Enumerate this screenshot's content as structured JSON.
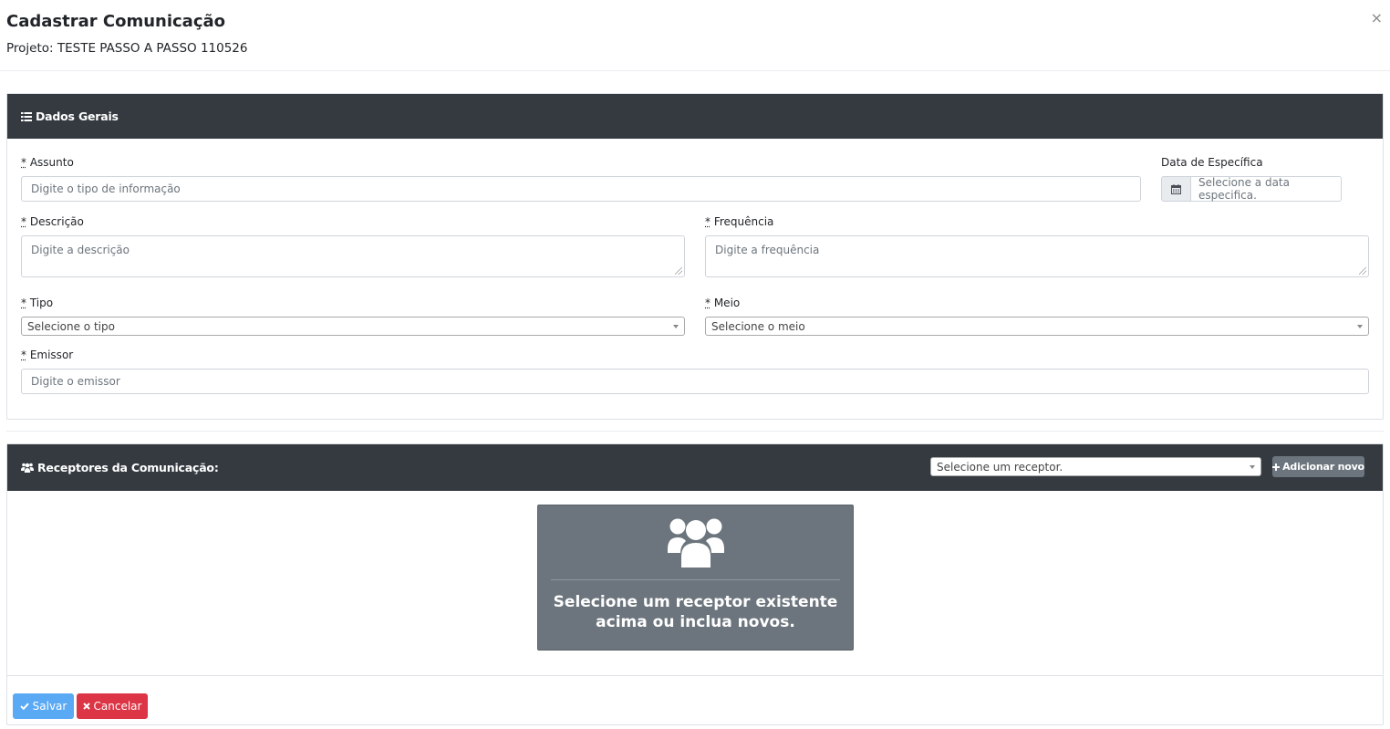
{
  "modal": {
    "title": "Cadastrar Comunicação",
    "subtitle": "Projeto: TESTE PASSO A PASSO 110526",
    "close": "×"
  },
  "general": {
    "title": "Dados Gerais",
    "required_mark": "*",
    "assunto": {
      "label": "Assunto",
      "placeholder": "Digite o tipo de informação"
    },
    "data": {
      "label": "Data de Específica",
      "placeholder": "Selecione a data especifica."
    },
    "descricao": {
      "label": "Descrição",
      "placeholder": "Digite a descrição"
    },
    "frequencia": {
      "label": "Frequência",
      "placeholder": "Digite a frequência"
    },
    "tipo": {
      "label": "Tipo",
      "value": "Selecione o tipo"
    },
    "meio": {
      "label": "Meio",
      "value": "Selecione o meio"
    },
    "emissor": {
      "label": "Emissor",
      "placeholder": "Digite o emissor"
    }
  },
  "receivers": {
    "title": "Receptores da Comunicação:",
    "select_value": "Selecione um receptor.",
    "add_label": "Adicionar novo",
    "empty_text": "Selecione um receptor existente acima ou inclua novos."
  },
  "footer": {
    "save_label": "Salvar",
    "cancel_label": "Cancelar"
  },
  "colors": {
    "header_dark": "#343a40",
    "secondary": "#6c757d",
    "save": "#5aa9f5",
    "cancel": "#dc3545"
  }
}
